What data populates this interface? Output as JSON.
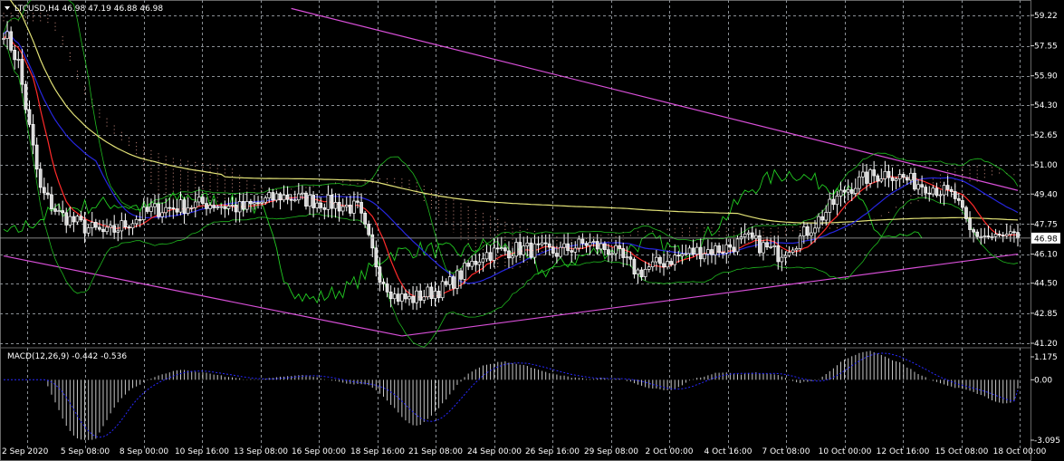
{
  "header": {
    "symbol_line": "LTCUSD,H4  46.98 47.19 46.88 46.98",
    "macd_line": "MACD(12,26,9) -0.442 -0.536"
  },
  "current_price": "46.98",
  "colors": {
    "background": "#000000",
    "grid": "#8a8f94",
    "bull": "#ffffff",
    "bear": "#d8d8d8",
    "ma_long": "#e2e277",
    "ma_fast": "#ff2a2a",
    "ma_mid": "#2626e0",
    "bands": "#1fb81f",
    "chikou": "#22cc22",
    "trendline": "#d84fd8",
    "cloud": "#ffb0a0",
    "price_line": "#b0b0b0",
    "macd_hist": "#c8c8c8",
    "macd_signal": "#2828ff"
  },
  "chart_data": {
    "type": "candlestick",
    "symbol": "LTCUSD",
    "timeframe": "H4",
    "ohlc_last": {
      "open": 46.98,
      "high": 47.19,
      "low": 46.88,
      "close": 46.98
    },
    "price_axis": {
      "ticks": [
        "59.22",
        "57.55",
        "55.90",
        "54.30",
        "52.65",
        "51.00",
        "49.40",
        "47.75",
        "46.10",
        "44.50",
        "42.85",
        "41.20"
      ],
      "ylim": [
        41.2,
        59.22
      ]
    },
    "time_axis": {
      "ticks": [
        "2 Sep 2020",
        "5 Sep 08:00",
        "8 Sep 00:00",
        "10 Sep 16:00",
        "13 Sep 08:00",
        "16 Sep 00:00",
        "18 Sep 16:00",
        "21 Sep 08:00",
        "24 Sep 00:00",
        "26 Sep 16:00",
        "29 Sep 08:00",
        "2 Oct 00:00",
        "4 Oct 16:00",
        "7 Oct 08:00",
        "10 Oct 00:00",
        "12 Oct 16:00",
        "15 Oct 08:00",
        "18 Oct 00:00"
      ]
    },
    "price_keypoints": [
      {
        "t": 0,
        "p": 58.4
      },
      {
        "t": 4,
        "p": 56.6
      },
      {
        "t": 7,
        "p": 53.0
      },
      {
        "t": 10,
        "p": 49.6
      },
      {
        "t": 15,
        "p": 48.3
      },
      {
        "t": 22,
        "p": 47.6
      },
      {
        "t": 28,
        "p": 47.2
      },
      {
        "t": 40,
        "p": 48.5
      },
      {
        "t": 55,
        "p": 48.9
      },
      {
        "t": 65,
        "p": 48.6
      },
      {
        "t": 75,
        "p": 49.3
      },
      {
        "t": 88,
        "p": 48.9
      },
      {
        "t": 96,
        "p": 48.6
      },
      {
        "t": 102,
        "p": 45.0
      },
      {
        "t": 106,
        "p": 43.8
      },
      {
        "t": 110,
        "p": 43.6
      },
      {
        "t": 116,
        "p": 44.0
      },
      {
        "t": 120,
        "p": 44.3
      },
      {
        "t": 124,
        "p": 45.0
      },
      {
        "t": 130,
        "p": 46.1
      },
      {
        "t": 140,
        "p": 46.4
      },
      {
        "t": 150,
        "p": 46.2
      },
      {
        "t": 158,
        "p": 46.7
      },
      {
        "t": 165,
        "p": 46.3
      },
      {
        "t": 172,
        "p": 45.1
      },
      {
        "t": 178,
        "p": 45.6
      },
      {
        "t": 186,
        "p": 46.2
      },
      {
        "t": 195,
        "p": 46.4
      },
      {
        "t": 202,
        "p": 46.9
      },
      {
        "t": 210,
        "p": 46.1
      },
      {
        "t": 216,
        "p": 47.0
      },
      {
        "t": 222,
        "p": 48.2
      },
      {
        "t": 228,
        "p": 49.6
      },
      {
        "t": 234,
        "p": 50.3
      },
      {
        "t": 240,
        "p": 50.6
      },
      {
        "t": 246,
        "p": 50.1
      },
      {
        "t": 252,
        "p": 49.8
      },
      {
        "t": 258,
        "p": 49.2
      },
      {
        "t": 262,
        "p": 47.3
      },
      {
        "t": 268,
        "p": 47.0
      },
      {
        "t": 275,
        "p": 46.98
      }
    ],
    "trendlines": [
      {
        "name": "upper",
        "from": {
          "t": 78,
          "p": 59.6
        },
        "to": {
          "t": 275,
          "p": 49.6
        }
      },
      {
        "name": "lower-left",
        "from": {
          "t": 0,
          "p": 46.0
        },
        "to": {
          "t": 108,
          "p": 41.6
        }
      },
      {
        "name": "lower-right",
        "from": {
          "t": 108,
          "p": 41.6
        },
        "to": {
          "t": 275,
          "p": 46.1
        }
      }
    ],
    "macd": {
      "params": "12,26,9",
      "macd": -0.442,
      "signal": -0.536,
      "ylim": [
        -3.095,
        1.175
      ],
      "ticks": [
        "1.175",
        "0.00",
        "-3.095"
      ]
    }
  }
}
